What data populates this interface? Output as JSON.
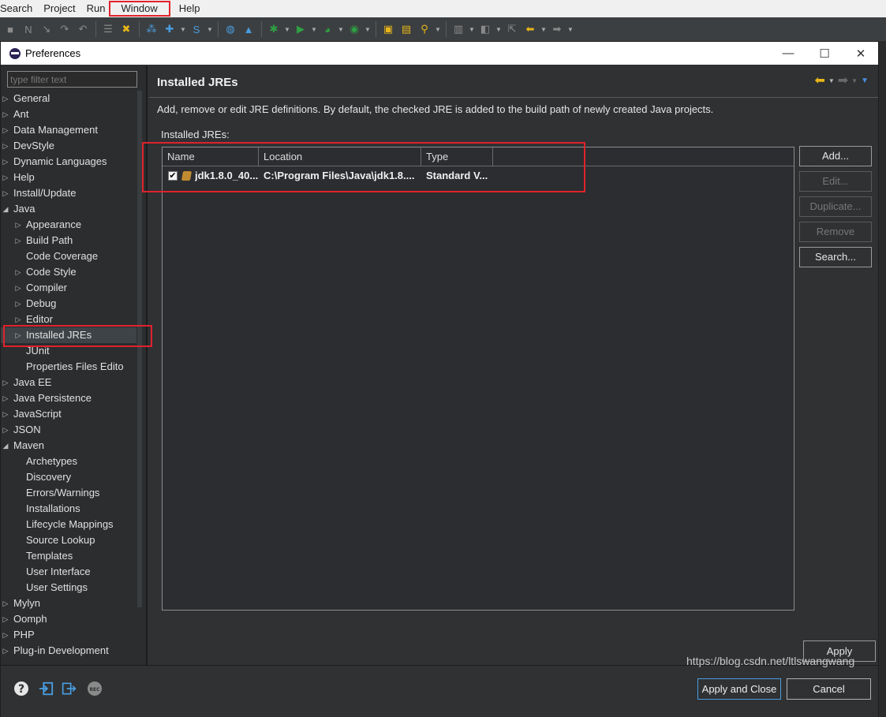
{
  "menubar": {
    "items": [
      "Search",
      "Project",
      "Run",
      "Window",
      "Help"
    ]
  },
  "dialog": {
    "title": "Preferences",
    "filter_placeholder": "type filter text",
    "tree": [
      {
        "label": "General",
        "level": 0,
        "state": "collapsed"
      },
      {
        "label": "Ant",
        "level": 0,
        "state": "collapsed"
      },
      {
        "label": "Data Management",
        "level": 0,
        "state": "collapsed"
      },
      {
        "label": "DevStyle",
        "level": 0,
        "state": "collapsed"
      },
      {
        "label": "Dynamic Languages",
        "level": 0,
        "state": "collapsed"
      },
      {
        "label": "Help",
        "level": 0,
        "state": "collapsed"
      },
      {
        "label": "Install/Update",
        "level": 0,
        "state": "collapsed"
      },
      {
        "label": "Java",
        "level": 0,
        "state": "expanded"
      },
      {
        "label": "Appearance",
        "level": 1,
        "state": "collapsed"
      },
      {
        "label": "Build Path",
        "level": 1,
        "state": "collapsed"
      },
      {
        "label": "Code Coverage",
        "level": 1,
        "state": "leaf"
      },
      {
        "label": "Code Style",
        "level": 1,
        "state": "collapsed"
      },
      {
        "label": "Compiler",
        "level": 1,
        "state": "collapsed"
      },
      {
        "label": "Debug",
        "level": 1,
        "state": "collapsed"
      },
      {
        "label": "Editor",
        "level": 1,
        "state": "collapsed"
      },
      {
        "label": "Installed JREs",
        "level": 1,
        "state": "collapsed",
        "selected": true
      },
      {
        "label": "JUnit",
        "level": 1,
        "state": "leaf"
      },
      {
        "label": "Properties Files Edito",
        "level": 1,
        "state": "leaf"
      },
      {
        "label": "Java EE",
        "level": 0,
        "state": "collapsed"
      },
      {
        "label": "Java Persistence",
        "level": 0,
        "state": "collapsed"
      },
      {
        "label": "JavaScript",
        "level": 0,
        "state": "collapsed"
      },
      {
        "label": "JSON",
        "level": 0,
        "state": "collapsed"
      },
      {
        "label": "Maven",
        "level": 0,
        "state": "expanded"
      },
      {
        "label": "Archetypes",
        "level": 1,
        "state": "leaf"
      },
      {
        "label": "Discovery",
        "level": 1,
        "state": "leaf"
      },
      {
        "label": "Errors/Warnings",
        "level": 1,
        "state": "leaf"
      },
      {
        "label": "Installations",
        "level": 1,
        "state": "leaf"
      },
      {
        "label": "Lifecycle Mappings",
        "level": 1,
        "state": "leaf"
      },
      {
        "label": "Source Lookup",
        "level": 1,
        "state": "leaf"
      },
      {
        "label": "Templates",
        "level": 1,
        "state": "leaf"
      },
      {
        "label": "User Interface",
        "level": 1,
        "state": "leaf"
      },
      {
        "label": "User Settings",
        "level": 1,
        "state": "leaf"
      },
      {
        "label": "Mylyn",
        "level": 0,
        "state": "collapsed"
      },
      {
        "label": "Oomph",
        "level": 0,
        "state": "collapsed"
      },
      {
        "label": "PHP",
        "level": 0,
        "state": "collapsed"
      },
      {
        "label": "Plug-in Development",
        "level": 0,
        "state": "collapsed"
      }
    ],
    "page": {
      "title": "Installed JREs",
      "description": "Add, remove or edit JRE definitions. By default, the checked JRE is added to the build path of newly created Java projects.",
      "list_label": "Installed JREs:",
      "columns": [
        "Name",
        "Location",
        "Type"
      ],
      "rows": [
        {
          "checked": true,
          "name": "jdk1.8.0_40...",
          "location": "C:\\Program Files\\Java\\jdk1.8....",
          "type": "Standard V..."
        }
      ],
      "buttons": {
        "add": "Add...",
        "edit": "Edit...",
        "duplicate": "Duplicate...",
        "remove": "Remove",
        "search": "Search..."
      },
      "apply": "Apply"
    },
    "footer": {
      "apply_close": "Apply and Close",
      "cancel": "Cancel"
    }
  },
  "watermark": "https://blog.csdn.net/ltlswangwang",
  "colors": {
    "highlight": "#e0222c",
    "accent_arrow": "#e8b61a"
  }
}
